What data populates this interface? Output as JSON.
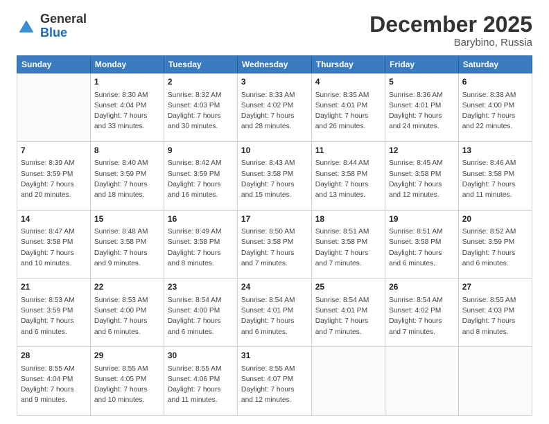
{
  "header": {
    "logo_general": "General",
    "logo_blue": "Blue",
    "month_title": "December 2025",
    "location": "Barybino, Russia"
  },
  "days_of_week": [
    "Sunday",
    "Monday",
    "Tuesday",
    "Wednesday",
    "Thursday",
    "Friday",
    "Saturday"
  ],
  "weeks": [
    [
      {
        "day": "",
        "sunrise": "",
        "sunset": "",
        "daylight": ""
      },
      {
        "day": "1",
        "sunrise": "Sunrise: 8:30 AM",
        "sunset": "Sunset: 4:04 PM",
        "daylight": "Daylight: 7 hours and 33 minutes."
      },
      {
        "day": "2",
        "sunrise": "Sunrise: 8:32 AM",
        "sunset": "Sunset: 4:03 PM",
        "daylight": "Daylight: 7 hours and 30 minutes."
      },
      {
        "day": "3",
        "sunrise": "Sunrise: 8:33 AM",
        "sunset": "Sunset: 4:02 PM",
        "daylight": "Daylight: 7 hours and 28 minutes."
      },
      {
        "day": "4",
        "sunrise": "Sunrise: 8:35 AM",
        "sunset": "Sunset: 4:01 PM",
        "daylight": "Daylight: 7 hours and 26 minutes."
      },
      {
        "day": "5",
        "sunrise": "Sunrise: 8:36 AM",
        "sunset": "Sunset: 4:01 PM",
        "daylight": "Daylight: 7 hours and 24 minutes."
      },
      {
        "day": "6",
        "sunrise": "Sunrise: 8:38 AM",
        "sunset": "Sunset: 4:00 PM",
        "daylight": "Daylight: 7 hours and 22 minutes."
      }
    ],
    [
      {
        "day": "7",
        "sunrise": "Sunrise: 8:39 AM",
        "sunset": "Sunset: 3:59 PM",
        "daylight": "Daylight: 7 hours and 20 minutes."
      },
      {
        "day": "8",
        "sunrise": "Sunrise: 8:40 AM",
        "sunset": "Sunset: 3:59 PM",
        "daylight": "Daylight: 7 hours and 18 minutes."
      },
      {
        "day": "9",
        "sunrise": "Sunrise: 8:42 AM",
        "sunset": "Sunset: 3:59 PM",
        "daylight": "Daylight: 7 hours and 16 minutes."
      },
      {
        "day": "10",
        "sunrise": "Sunrise: 8:43 AM",
        "sunset": "Sunset: 3:58 PM",
        "daylight": "Daylight: 7 hours and 15 minutes."
      },
      {
        "day": "11",
        "sunrise": "Sunrise: 8:44 AM",
        "sunset": "Sunset: 3:58 PM",
        "daylight": "Daylight: 7 hours and 13 minutes."
      },
      {
        "day": "12",
        "sunrise": "Sunrise: 8:45 AM",
        "sunset": "Sunset: 3:58 PM",
        "daylight": "Daylight: 7 hours and 12 minutes."
      },
      {
        "day": "13",
        "sunrise": "Sunrise: 8:46 AM",
        "sunset": "Sunset: 3:58 PM",
        "daylight": "Daylight: 7 hours and 11 minutes."
      }
    ],
    [
      {
        "day": "14",
        "sunrise": "Sunrise: 8:47 AM",
        "sunset": "Sunset: 3:58 PM",
        "daylight": "Daylight: 7 hours and 10 minutes."
      },
      {
        "day": "15",
        "sunrise": "Sunrise: 8:48 AM",
        "sunset": "Sunset: 3:58 PM",
        "daylight": "Daylight: 7 hours and 9 minutes."
      },
      {
        "day": "16",
        "sunrise": "Sunrise: 8:49 AM",
        "sunset": "Sunset: 3:58 PM",
        "daylight": "Daylight: 7 hours and 8 minutes."
      },
      {
        "day": "17",
        "sunrise": "Sunrise: 8:50 AM",
        "sunset": "Sunset: 3:58 PM",
        "daylight": "Daylight: 7 hours and 7 minutes."
      },
      {
        "day": "18",
        "sunrise": "Sunrise: 8:51 AM",
        "sunset": "Sunset: 3:58 PM",
        "daylight": "Daylight: 7 hours and 7 minutes."
      },
      {
        "day": "19",
        "sunrise": "Sunrise: 8:51 AM",
        "sunset": "Sunset: 3:58 PM",
        "daylight": "Daylight: 7 hours and 6 minutes."
      },
      {
        "day": "20",
        "sunrise": "Sunrise: 8:52 AM",
        "sunset": "Sunset: 3:59 PM",
        "daylight": "Daylight: 7 hours and 6 minutes."
      }
    ],
    [
      {
        "day": "21",
        "sunrise": "Sunrise: 8:53 AM",
        "sunset": "Sunset: 3:59 PM",
        "daylight": "Daylight: 7 hours and 6 minutes."
      },
      {
        "day": "22",
        "sunrise": "Sunrise: 8:53 AM",
        "sunset": "Sunset: 4:00 PM",
        "daylight": "Daylight: 7 hours and 6 minutes."
      },
      {
        "day": "23",
        "sunrise": "Sunrise: 8:54 AM",
        "sunset": "Sunset: 4:00 PM",
        "daylight": "Daylight: 7 hours and 6 minutes."
      },
      {
        "day": "24",
        "sunrise": "Sunrise: 8:54 AM",
        "sunset": "Sunset: 4:01 PM",
        "daylight": "Daylight: 7 hours and 6 minutes."
      },
      {
        "day": "25",
        "sunrise": "Sunrise: 8:54 AM",
        "sunset": "Sunset: 4:01 PM",
        "daylight": "Daylight: 7 hours and 7 minutes."
      },
      {
        "day": "26",
        "sunrise": "Sunrise: 8:54 AM",
        "sunset": "Sunset: 4:02 PM",
        "daylight": "Daylight: 7 hours and 7 minutes."
      },
      {
        "day": "27",
        "sunrise": "Sunrise: 8:55 AM",
        "sunset": "Sunset: 4:03 PM",
        "daylight": "Daylight: 7 hours and 8 minutes."
      }
    ],
    [
      {
        "day": "28",
        "sunrise": "Sunrise: 8:55 AM",
        "sunset": "Sunset: 4:04 PM",
        "daylight": "Daylight: 7 hours and 9 minutes."
      },
      {
        "day": "29",
        "sunrise": "Sunrise: 8:55 AM",
        "sunset": "Sunset: 4:05 PM",
        "daylight": "Daylight: 7 hours and 10 minutes."
      },
      {
        "day": "30",
        "sunrise": "Sunrise: 8:55 AM",
        "sunset": "Sunset: 4:06 PM",
        "daylight": "Daylight: 7 hours and 11 minutes."
      },
      {
        "day": "31",
        "sunrise": "Sunrise: 8:55 AM",
        "sunset": "Sunset: 4:07 PM",
        "daylight": "Daylight: 7 hours and 12 minutes."
      },
      {
        "day": "",
        "sunrise": "",
        "sunset": "",
        "daylight": ""
      },
      {
        "day": "",
        "sunrise": "",
        "sunset": "",
        "daylight": ""
      },
      {
        "day": "",
        "sunrise": "",
        "sunset": "",
        "daylight": ""
      }
    ]
  ]
}
